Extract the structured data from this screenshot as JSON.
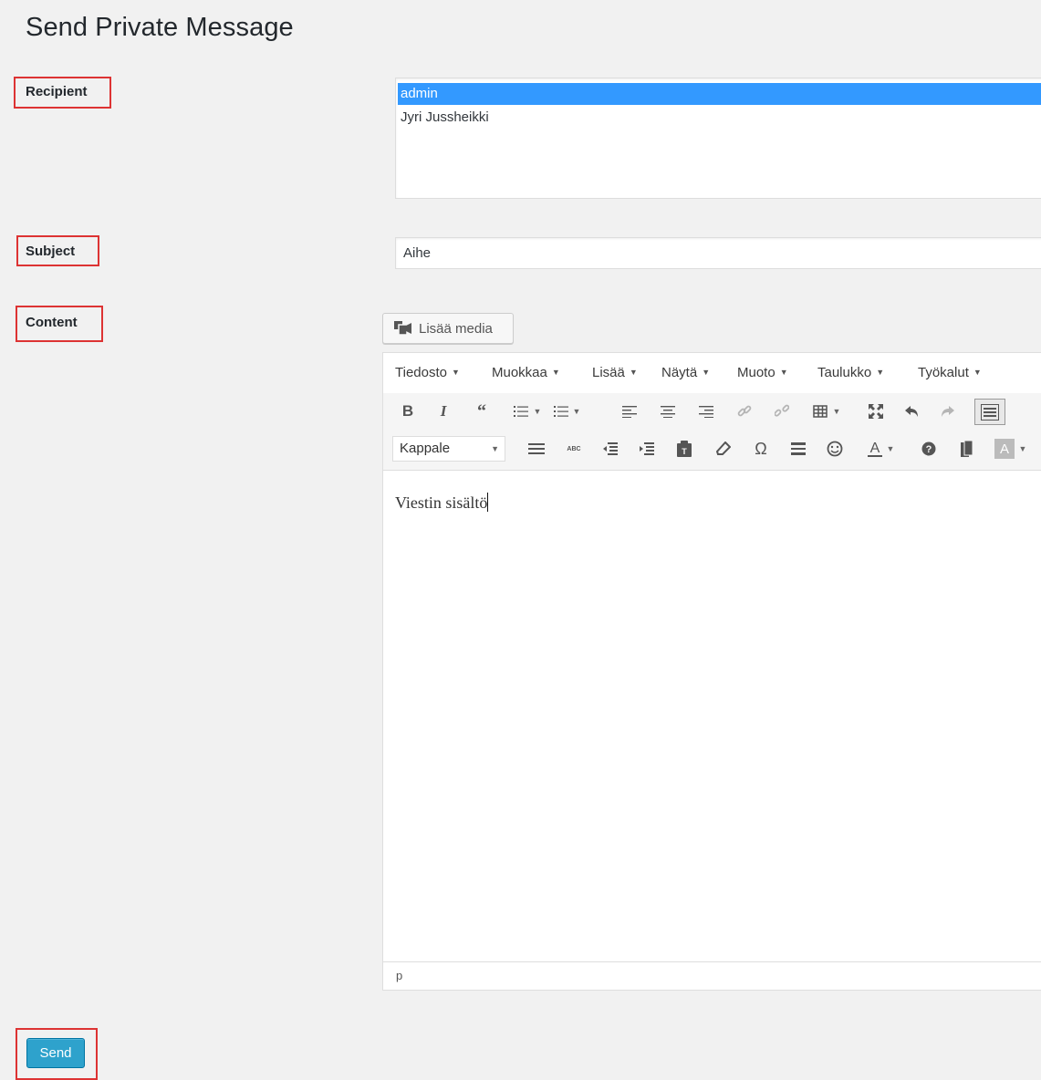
{
  "page": {
    "title": "Send Private Message"
  },
  "labels": {
    "recipient": "Recipient",
    "subject": "Subject",
    "content": "Content"
  },
  "recipients": {
    "options": [
      "admin",
      "Jyri Jussheikki"
    ],
    "selected": "admin"
  },
  "subject": {
    "value": "Aihe"
  },
  "editor": {
    "add_media_label": "Lisää media",
    "menus": [
      "Tiedosto",
      "Muokkaa",
      "Lisää",
      "Näytä",
      "Muoto",
      "Taulukko",
      "Työkalut"
    ],
    "format_select_value": "Kappale",
    "content_text": "Viestin sisältö",
    "status_path": "p",
    "toolbar_row1_icons": [
      "bold-icon",
      "italic-icon",
      "blockquote-icon",
      "bullet-list-icon",
      "numbered-list-icon",
      "align-left-icon",
      "align-center-icon",
      "align-right-icon",
      "link-icon",
      "unlink-icon",
      "table-icon",
      "fullscreen-icon",
      "undo-icon",
      "redo-icon",
      "toolbar-toggle-icon"
    ],
    "toolbar_row2_icons": [
      "justify-icon",
      "strikethrough-icon",
      "outdent-icon",
      "indent-icon",
      "paste-text-icon",
      "clear-formatting-icon",
      "special-character-icon",
      "horizontal-line-icon",
      "emoticon-icon",
      "text-color-icon",
      "help-icon",
      "page-break-icon",
      "background-color-icon"
    ]
  },
  "send_button": {
    "label": "Send"
  },
  "colors": {
    "accent": "#2ea2cc",
    "selection": "#3399ff",
    "highlight_box": "#dd3333"
  }
}
